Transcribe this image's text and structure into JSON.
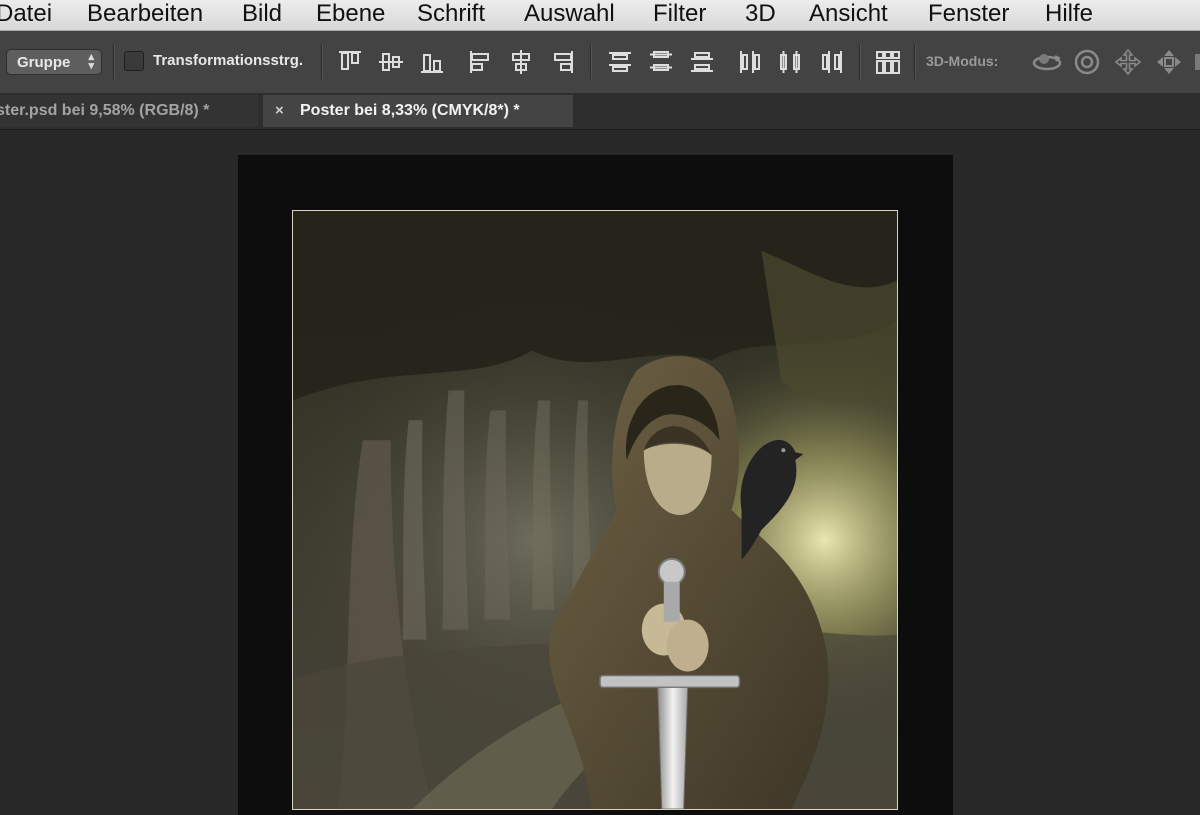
{
  "menu": [
    "Datei",
    "Bearbeiten",
    "Bild",
    "Ebene",
    "Schrift",
    "Auswahl",
    "Filter",
    "3D",
    "Ansicht",
    "Fenster",
    "Hilfe"
  ],
  "options": {
    "group_select": "Gruppe",
    "transform_checkbox_label": "Transformationsstrg.",
    "transform_checked": false,
    "mode_label": "3D-Modus:"
  },
  "tabs": [
    {
      "title": "ster.psd bei 9,58% (RGB/8) *",
      "active": false
    },
    {
      "title": "Poster bei 8,33% (CMYK/8*) *",
      "active": true,
      "close": "×"
    }
  ],
  "icons": {
    "align": [
      "align-top-edges-icon",
      "align-vertical-centers-icon",
      "align-bottom-edges-icon",
      "align-left-edges-icon",
      "align-horizontal-centers-icon",
      "align-right-edges-icon"
    ],
    "distribute": [
      "distribute-top-edges-icon",
      "distribute-vertical-centers-icon",
      "distribute-bottom-edges-icon",
      "distribute-left-edges-icon",
      "distribute-horizontal-centers-icon",
      "distribute-right-edges-icon"
    ],
    "auto_align": "auto-align-layers-icon",
    "mode3d": [
      "3d-orbit-icon",
      "3d-roll-icon",
      "3d-pan-icon",
      "3d-slide-icon",
      "3d-scale-icon"
    ]
  },
  "colors": {
    "menubar": "#e4e4e4",
    "optionsbar": "#434343",
    "workspace": "#282828",
    "artboard": "#0d0d0d"
  }
}
